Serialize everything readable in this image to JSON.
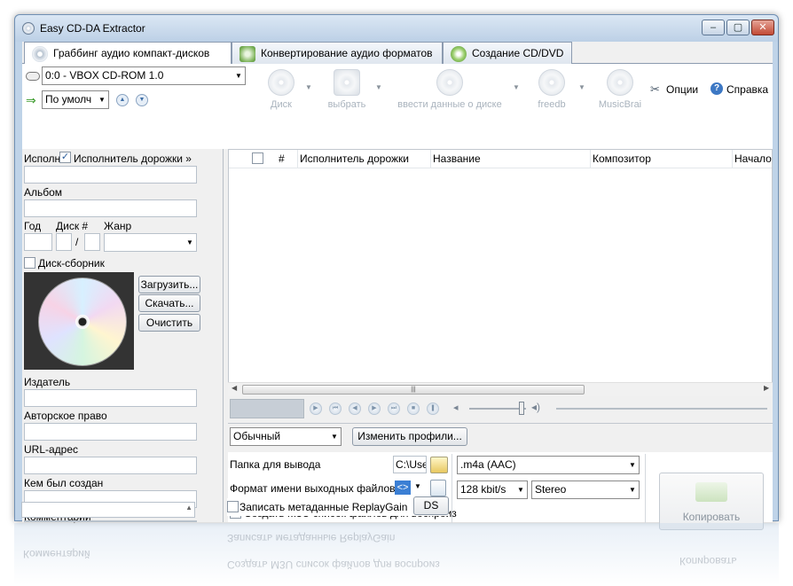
{
  "window": {
    "title": "Easy CD-DA Extractor",
    "min": "‒",
    "max": "▢",
    "close": "✕"
  },
  "tabs": [
    {
      "label": "Граббинг аудио компакт-дисков"
    },
    {
      "label": "Конвертирование аудио форматов"
    },
    {
      "label": "Создание CD/DVD"
    }
  ],
  "toolbar": {
    "drive": "0:0 - VBOX CD-ROM 1.0",
    "profile": "По умолч",
    "buttons": [
      {
        "label": "Диск"
      },
      {
        "label": "выбрать"
      },
      {
        "label": "ввести данные о диске"
      },
      {
        "label": "freedb"
      },
      {
        "label": "MusicBrai"
      }
    ],
    "options_label": "Опции",
    "help_label": "Справка"
  },
  "left": {
    "artist_label": "Исполн",
    "track_artist_label": "Исполнитель дорожки »",
    "track_artist_checked": true,
    "album_label": "Альбом",
    "year_label": "Год",
    "disc_label": "Диск #",
    "genre_label": "Жанр",
    "disc_sep": "/",
    "compilation_label": "Диск-сборник",
    "load_btn": "Загрузить...",
    "download_btn": "Скачать...",
    "clear_btn": "Очистить",
    "publisher_label": "Издатель",
    "copyright_label": "Авторское право",
    "url_label": "URL-адрес",
    "created_by_label": "Кем был создан",
    "comment_label": "Комментарий"
  },
  "list": {
    "columns": [
      "#",
      "Исполнитель дорожки",
      "Название",
      "Композитор",
      "Начало"
    ]
  },
  "scroll": {
    "thumb": "|||"
  },
  "bottom": {
    "mode": "Обычный",
    "edit_profiles_btn": "Изменить профили...",
    "output_folder_label": "Папка для вывода",
    "output_folder_value": "C:\\Use",
    "filename_format_label": "Формат имени выходных файлов",
    "filename_format_value": "<>",
    "m3u_label": "Создать M3U список файлов для воспроиз",
    "replaygain_label": "Записать метаданные ReplayGain",
    "ds_btn": "DS",
    "format": ".m4a (AAC)",
    "bitrate": "128 kbit/s",
    "channels": "Stereo",
    "copy_btn": "Копировать"
  }
}
